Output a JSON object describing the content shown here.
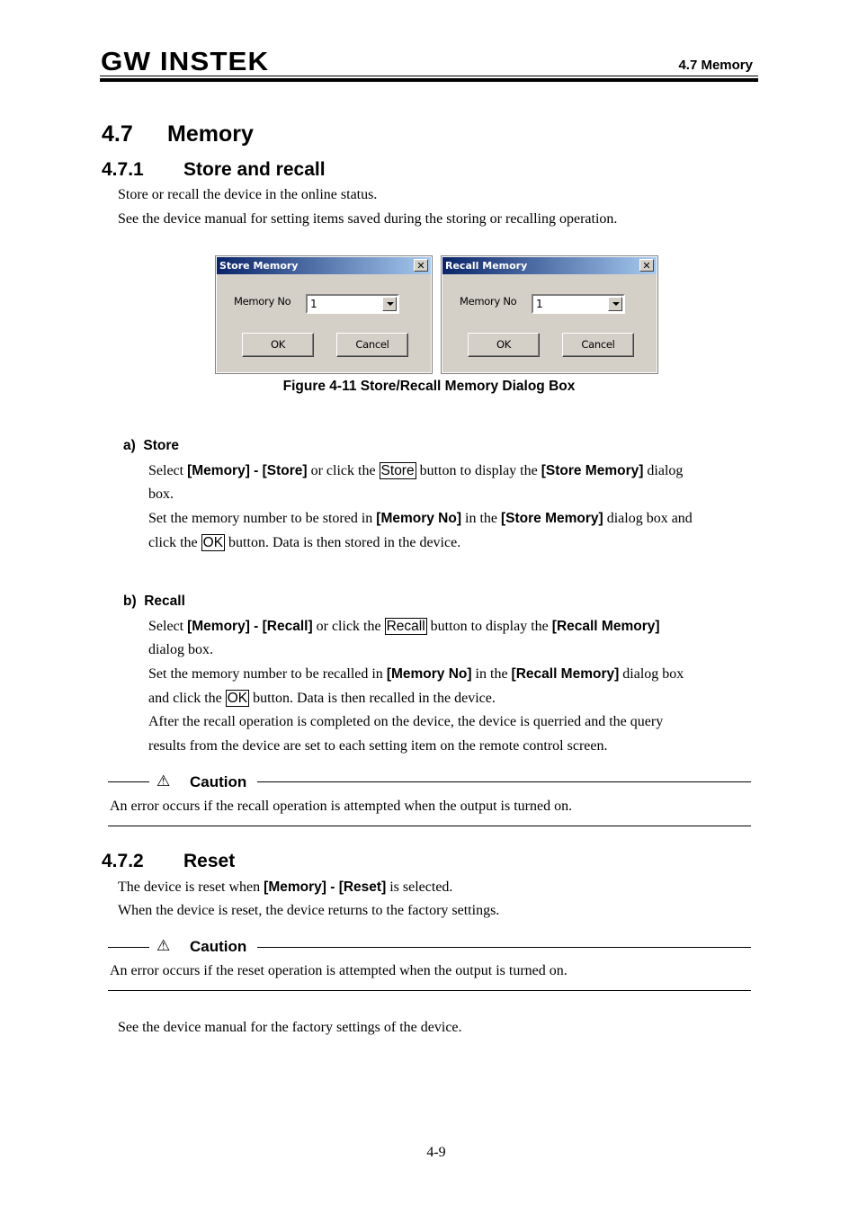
{
  "header": {
    "logo": "GW INSTEK",
    "section": "4.7 Memory"
  },
  "section": {
    "number": "4.7",
    "title": "Memory"
  },
  "subsection1": {
    "number": "4.7.1",
    "title": "Store and recall",
    "intro": [
      "Store or recall the device in the online status.",
      "See the device manual for setting items saved during the storing or recalling operation."
    ]
  },
  "dialogs": {
    "store": {
      "title": "Store Memory",
      "close_glyph": "✕",
      "label": "Memory No",
      "value": "1",
      "ok": "OK",
      "cancel": "Cancel"
    },
    "recall": {
      "title": "Recall Memory",
      "close_glyph": "✕",
      "label": "Memory No",
      "value": "1",
      "ok": "OK",
      "cancel": "Cancel"
    }
  },
  "figure_caption": "Figure 4-11  Store/Recall Memory Dialog Box",
  "store": {
    "heading": "a)  Store",
    "l1_a": "Select ",
    "l1_b": "[Memory] - [Store]",
    "l1_c": " or click the ",
    "l1_btn": "Store",
    "l1_d": " button to display the ",
    "l1_e": "[Store Memory]",
    "l1_f": " dialog",
    "l2": "box.",
    "l3_a": "Set the memory number to be stored in ",
    "l3_b": "[Memory No]",
    "l3_c": " in the ",
    "l3_d": "[Store Memory]",
    "l3_e": " dialog box and",
    "l4_a": "click the ",
    "l4_btn": "OK",
    "l4_b": " button. Data is then stored in the device."
  },
  "recall": {
    "heading": "b)  Recall",
    "l1_a": "Select ",
    "l1_b": "[Memory] - [Recall]",
    "l1_c": " or click the ",
    "l1_btn": "Recall",
    "l1_d": " button to display the ",
    "l1_e": "[Recall Memory]",
    "l2": "dialog box.",
    "l3_a": "Set the memory number to be recalled in ",
    "l3_b": "[Memory No]",
    "l3_c": " in the ",
    "l3_d": "[Recall Memory]",
    "l3_e": " dialog box",
    "l4_a": "and click the ",
    "l4_btn": "OK",
    "l4_b": " button. Data is then recalled in the device.",
    "l5": "After the recall operation is completed on the device, the device is querried and the query",
    "l6": "results from the device are set to each setting item on the remote control screen."
  },
  "caution1": {
    "icon": "⚠",
    "title": "Caution",
    "text": "An error occurs if the recall operation is attempted when the output is turned on."
  },
  "subsection2": {
    "number": "4.7.2",
    "title": "Reset",
    "l1_a": "The device is reset when ",
    "l1_b": "[Memory] - [Reset]",
    "l1_c": " is selected.",
    "l2": "When the device is reset, the device returns to the factory settings."
  },
  "caution2": {
    "icon": "⚠",
    "title": "Caution",
    "text": "An error occurs if the reset operation is attempted when the output is turned on."
  },
  "footnote": "See the device manual for the factory settings of the device.",
  "page_number": "4-9"
}
